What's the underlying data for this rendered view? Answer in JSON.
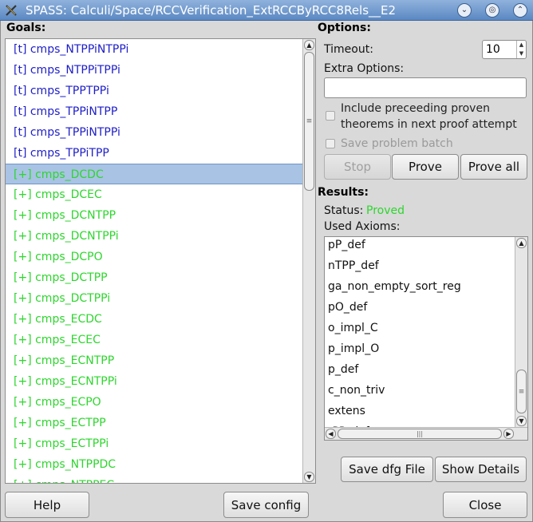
{
  "window": {
    "title": "SPASS: Calculi/Space/RCCVerification_ExtRCCByRCC8Rels__E2",
    "controls": {
      "shade": "◎",
      "minimize": "⌄",
      "maximize": "⌃"
    }
  },
  "goals": {
    "label": "Goals:",
    "items": [
      {
        "text": "[t] cmps_NTPPiNTPPi",
        "state": "blue"
      },
      {
        "text": "[t] cmps_NTPPiTPPi",
        "state": "blue"
      },
      {
        "text": "[t] cmps_TPPTPPi",
        "state": "blue"
      },
      {
        "text": "[t] cmps_TPPiNTPP",
        "state": "blue"
      },
      {
        "text": "[t] cmps_TPPiNTPPi",
        "state": "blue"
      },
      {
        "text": "[t] cmps_TPPiTPP",
        "state": "blue"
      },
      {
        "text": "[+] cmps_DCDC",
        "state": "green",
        "selected": true
      },
      {
        "text": "[+] cmps_DCEC",
        "state": "green"
      },
      {
        "text": "[+] cmps_DCNTPP",
        "state": "green"
      },
      {
        "text": "[+] cmps_DCNTPPi",
        "state": "green"
      },
      {
        "text": "[+] cmps_DCPO",
        "state": "green"
      },
      {
        "text": "[+] cmps_DCTPP",
        "state": "green"
      },
      {
        "text": "[+] cmps_DCTPPi",
        "state": "green"
      },
      {
        "text": "[+] cmps_ECDC",
        "state": "green"
      },
      {
        "text": "[+] cmps_ECEC",
        "state": "green"
      },
      {
        "text": "[+] cmps_ECNTPP",
        "state": "green"
      },
      {
        "text": "[+] cmps_ECNTPPi",
        "state": "green"
      },
      {
        "text": "[+] cmps_ECPO",
        "state": "green"
      },
      {
        "text": "[+] cmps_ECTPP",
        "state": "green"
      },
      {
        "text": "[+] cmps_ECTPPi",
        "state": "green"
      },
      {
        "text": "[+] cmps_NTPPDC",
        "state": "green"
      },
      {
        "text": "[+] cmps_NTPPEC",
        "state": "green"
      }
    ]
  },
  "options": {
    "label": "Options:",
    "timeout_label": "Timeout:",
    "timeout_value": "10",
    "extra_options_label": "Extra Options:",
    "extra_options_value": "",
    "include_line1": "Include preceeding proven",
    "include_line2": "theorems in next proof attempt",
    "include_checked": false,
    "save_batch_label": "Save problem batch",
    "save_batch_checked": false,
    "stop_label": "Stop",
    "prove_label": "Prove",
    "prove_all_label": "Prove all"
  },
  "results": {
    "label": "Results:",
    "status_label": "Status:",
    "status_value": "Proved",
    "status_color": "#2ed62e",
    "used_axioms_label": "Used Axioms:",
    "axioms": [
      "pP_def",
      "nTPP_def",
      "ga_non_empty_sort_reg",
      "pO_def",
      "o_impl_C",
      "p_impl_O",
      "p_def",
      "c_non_triv",
      "extens",
      "tPP_def"
    ],
    "save_dfg_label": "Save dfg File",
    "show_details_label": "Show Details"
  },
  "footer": {
    "help_label": "Help",
    "save_config_label": "Save config",
    "close_label": "Close"
  },
  "colors": {
    "untried_goal": "#1e1ec8",
    "proved_goal": "#2ed62e",
    "selection": "#a8c3e4",
    "titlebar": "#6f97cc"
  }
}
